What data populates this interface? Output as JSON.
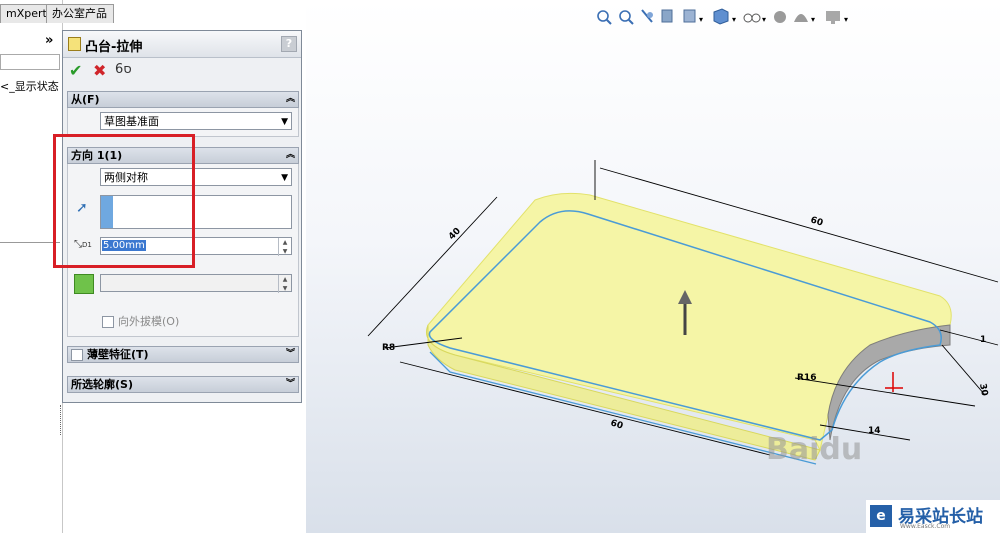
{
  "tabs": [
    "mXpert",
    "办公室产品"
  ],
  "left_panel": {
    "collapse_label": "»",
    "tree_item_label": "<_显示状态"
  },
  "property_manager": {
    "title": "凸台-拉伸",
    "help_label": "?",
    "from_section": {
      "label": "从(F)",
      "value": "草图基准面"
    },
    "direction1_section": {
      "label": "方向 1(1)",
      "end_condition": "两侧对称",
      "depth_value": "5.00mm",
      "depth_label": "D1",
      "draft_outward_label": "向外拔模(O)"
    },
    "thin_feature_label": "薄壁特征(T)",
    "selected_contours_label": "所选轮廓(S)"
  },
  "model_dimensions": {
    "top_length": "60",
    "left_width": "40",
    "bottom_length": "60",
    "radius_small": "R8",
    "radius_large": "R16",
    "right_dim_1": "1",
    "right_dim_2": "30",
    "small_dim": "14"
  },
  "watermark": {
    "brand_text": "Baidu",
    "site_name": "易采站长站",
    "site_url": "Www.Easck.Com"
  },
  "colors": {
    "highlight_box": "#d81f26",
    "model_fill": "#f3f3a8",
    "sketch_line": "#4a9bd6",
    "accept": "#2a9b2a",
    "cancel": "#d0252a"
  }
}
